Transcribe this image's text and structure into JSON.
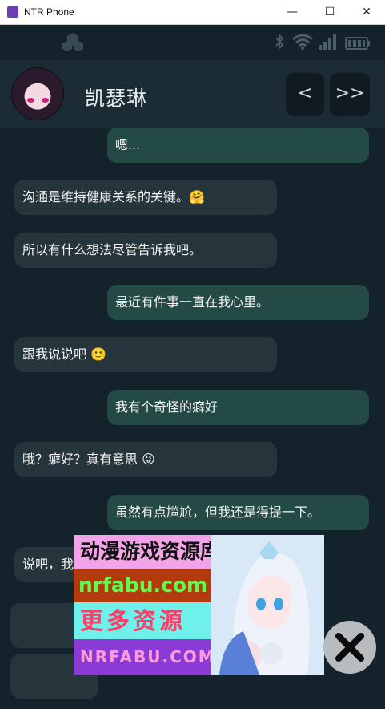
{
  "window": {
    "title": "NTR Phone",
    "minimize_symbol": "—",
    "maximize_symbol": "☐",
    "close_symbol": "✕"
  },
  "statusbar": {
    "icons": [
      "logo-icon",
      "bluetooth-icon",
      "wifi-icon",
      "signal-icon",
      "battery-icon"
    ]
  },
  "contact": {
    "name": "凯瑟琳",
    "prev_label": "<",
    "next_label": ">>"
  },
  "messages": [
    {
      "from": "me",
      "text": "嗯..."
    },
    {
      "from": "them",
      "text": "沟通是维持健康关系的关键。",
      "emoji": "🤗"
    },
    {
      "from": "them",
      "text": "所以有什么想法尽管告诉我吧。"
    },
    {
      "from": "me",
      "text": "最近有件事一直在我心里。"
    },
    {
      "from": "them",
      "text": "跟我说说吧",
      "emoji": "🙂"
    },
    {
      "from": "me",
      "text": "我有个奇怪的癖好"
    },
    {
      "from": "them",
      "text": "哦？癖好？真有意思",
      "emoji": "😜"
    },
    {
      "from": "me",
      "text": "虽然有点尴尬，但我还是得提一下。"
    },
    {
      "from": "them",
      "text": "说吧，我"
    }
  ],
  "ad": {
    "line1": "动漫游戏资源库",
    "line2": "nrfabu.com",
    "line3": "更多资源",
    "line4": "NRFABU.COM"
  },
  "colors": {
    "background": "#13222b",
    "incoming_bubble": "#26343c",
    "outgoing_bubble": "#234a44",
    "header": "#1b2c34"
  }
}
